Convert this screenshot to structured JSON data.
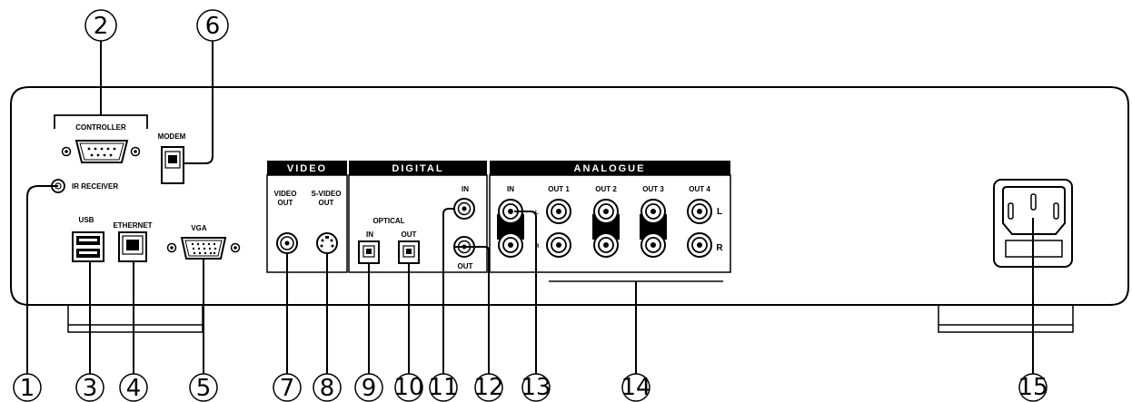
{
  "sections": {
    "video": "VIDEO",
    "digital": "DIGITAL",
    "analogue": "ANALOGUE"
  },
  "labels": {
    "controller": "CONTROLLER",
    "modem": "MODEM",
    "ir_receiver": "IR RECEIVER",
    "usb": "USB",
    "ethernet": "ETHERNET",
    "vga": "VGA",
    "video_out_1": "VIDEO",
    "video_out_2": "OUT",
    "svideo_out_1": "S-VIDEO",
    "svideo_out_2": "OUT",
    "optical": "OPTICAL",
    "optical_in": "IN",
    "optical_out": "OUT",
    "coax_in": "IN",
    "coax_out": "OUT",
    "analogue_in": "IN",
    "out1": "OUT 1",
    "out2": "OUT 2",
    "out3": "OUT 3",
    "out4": "OUT 4",
    "left": "L",
    "right": "R",
    "left_small": "L",
    "right_small": "R"
  },
  "callouts": [
    "1",
    "2",
    "3",
    "4",
    "5",
    "6",
    "7",
    "8",
    "9",
    "10",
    "11",
    "12",
    "13",
    "14",
    "15"
  ]
}
